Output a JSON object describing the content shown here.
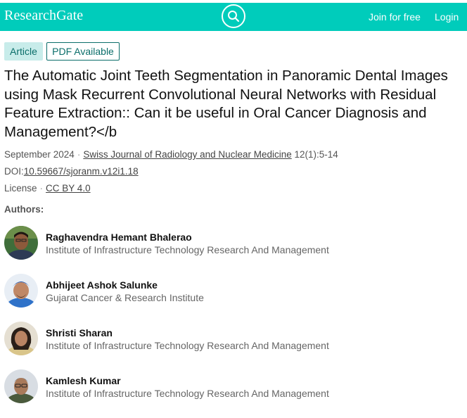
{
  "header": {
    "logo": "ResearchGate",
    "search_icon": "search-icon",
    "join_label": "Join for free",
    "login_label": "Login",
    "brand_color": "#00ccbb"
  },
  "badges": {
    "type": "Article",
    "pdf": "PDF Available"
  },
  "title": "The Automatic Joint Teeth Segmentation in Panoramic Dental Images using Mask Recurrent Convolutional Neural Networks with Residual Feature Extraction:: Can it be useful in Oral Cancer Diagnosis and Management?</b",
  "meta": {
    "date": "September 2024",
    "journal": "Swiss Journal of Radiology and Nuclear Medicine",
    "volume": "12(1):5-14",
    "doi_label": "DOI:",
    "doi": "10.59667/sjoranm.v12i1.18",
    "license_label": "License",
    "license": "CC BY 4.0"
  },
  "authors_heading": "Authors:",
  "authors": [
    {
      "name": "Raghavendra Hemant Bhalerao",
      "institution": "Institute of Infrastructure Technology Research And Management"
    },
    {
      "name": "Abhijeet Ashok Salunke",
      "institution": "Gujarat Cancer & Research Institute"
    },
    {
      "name": "Shristi Sharan",
      "institution": "Institute of Infrastructure Technology Research And Management"
    },
    {
      "name": "Kamlesh Kumar",
      "institution": "Institute of Infrastructure Technology Research And Management"
    }
  ]
}
